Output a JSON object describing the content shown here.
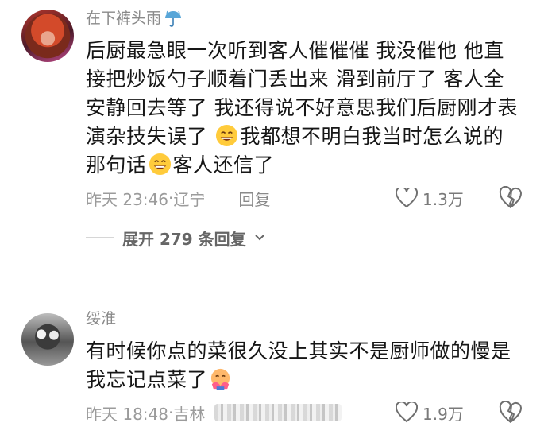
{
  "comments": [
    {
      "username": "在下裤头雨",
      "lines": [
        "后厨最急眼一次听到客人催催催 我没催他 他直",
        "接把炒饭勺子顺着门丢出来 滑到前厅了 客人全",
        "安静回去等了 我还得说不好意思我们后厨刚才表",
        "演杂技失误了",
        "我都想不明白我当时怎么说的",
        "那句话",
        "客人还信了"
      ],
      "time": "昨天 23:46",
      "location": "辽宁",
      "reply_label": "回复",
      "likes": "1.3万",
      "expand_label": "展开 279 条回复"
    },
    {
      "username": "绥淮",
      "lines": [
        "有时候你点的菜很久没上其实不是厨师做的慢是",
        "我忘记点菜了"
      ],
      "time": "昨天 18:48",
      "location": "吉林",
      "likes": "1.9万"
    }
  ]
}
